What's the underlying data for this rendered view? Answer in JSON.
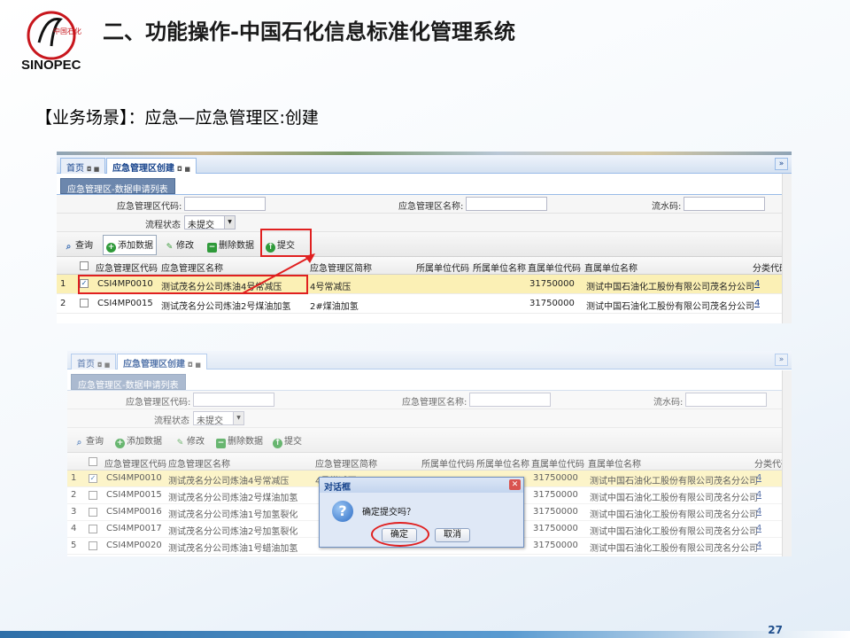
{
  "slide": {
    "logo_text": "中国石化",
    "logo_word": "SINOPEC",
    "title": "二、功能操作-中国石化信息标准化管理系统",
    "scene": "【业务场景】：应急—应急管理区:创建",
    "page_number": "27"
  },
  "app": {
    "tabs": [
      "首页",
      "应急管理区创建"
    ],
    "subtab": "应急管理区-数据申请列表",
    "form": {
      "code_label": "应急管理区代码:",
      "name_label": "应急管理区名称:",
      "serial_label": "流水码:",
      "status_label": "流程状态",
      "status_value": "未提交"
    },
    "toolbar": {
      "query": "查询",
      "add": "添加数据",
      "edit": "修改",
      "delete": "删除数据",
      "submit": "提交"
    },
    "columns": [
      "应急管理区代码",
      "应急管理区名称",
      "应急管理区简称",
      "所属单位代码",
      "所属单位名称",
      "直属单位代码",
      "直属单位名称",
      "分类代码"
    ],
    "rows1": [
      {
        "n": "1",
        "code": "CSI4MP0010",
        "name": "测试茂名分公司炼油4号常减压",
        "short": "4号常减压",
        "direct_code": "31750000",
        "direct_name": "测试中国石油化工股份有限公司茂名分公司",
        "cat": "4",
        "checked": "✓"
      },
      {
        "n": "2",
        "code": "CSI4MP0015",
        "name": "测试茂名分公司炼油2号煤油加氢",
        "short": "2#煤油加氢",
        "direct_code": "31750000",
        "direct_name": "测试中国石油化工股份有限公司茂名分公司",
        "cat": "4",
        "checked": ""
      }
    ],
    "rows2": [
      {
        "n": "1",
        "code": "CSI4MP0010",
        "name": "测试茂名分公司炼油4号常减压",
        "short": "4号常减压",
        "direct_code": "31750000",
        "direct_name": "测试中国石油化工股份有限公司茂名分公司",
        "cat": "4",
        "checked": "✓"
      },
      {
        "n": "2",
        "code": "CSI4MP0015",
        "name": "测试茂名分公司炼油2号煤油加氢",
        "short": "",
        "direct_code": "31750000",
        "direct_name": "测试中国石油化工股份有限公司茂名分公司",
        "cat": "4",
        "checked": ""
      },
      {
        "n": "3",
        "code": "CSI4MP0016",
        "name": "测试茂名分公司炼油1号加氢裂化",
        "short": "",
        "direct_code": "31750000",
        "direct_name": "测试中国石油化工股份有限公司茂名分公司",
        "cat": "4",
        "checked": ""
      },
      {
        "n": "4",
        "code": "CSI4MP0017",
        "name": "测试茂名分公司炼油2号加氢裂化",
        "short": "",
        "direct_code": "31750000",
        "direct_name": "测试中国石油化工股份有限公司茂名分公司",
        "cat": "4",
        "checked": ""
      },
      {
        "n": "5",
        "code": "CSI4MP0020",
        "name": "测试茂名分公司炼油1号蜡油加氢",
        "short": "",
        "direct_code": "31750000",
        "direct_name": "测试中国石油化工股份有限公司茂名分公司",
        "cat": "4",
        "checked": ""
      }
    ],
    "dialog": {
      "title": "对话框",
      "message": "确定提交吗？",
      "ok": "确定",
      "cancel": "取消"
    }
  }
}
